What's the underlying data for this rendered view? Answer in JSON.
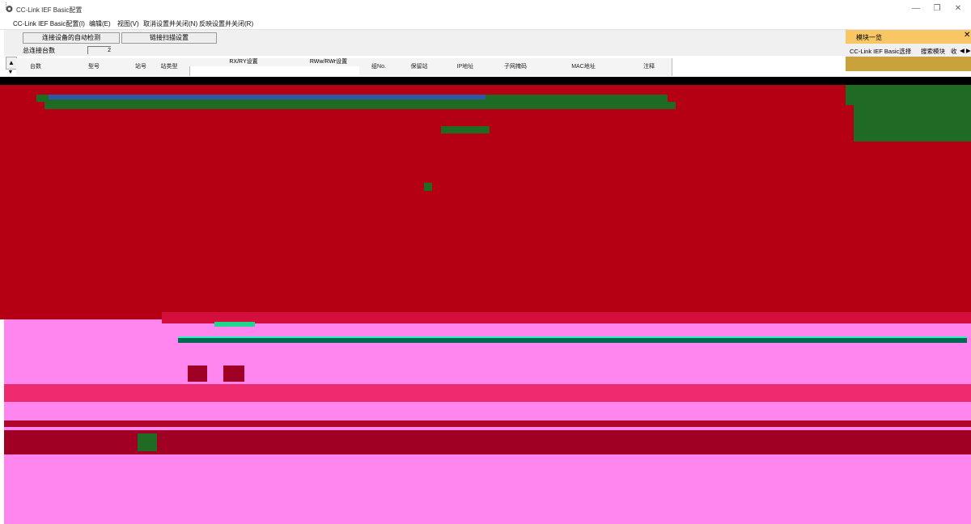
{
  "window": {
    "title": "CC-Link IEF Basic配置",
    "minimize_glyph": "—",
    "restore_glyph": "❐",
    "close_glyph": "✕"
  },
  "menu": [
    "CC-Link IEF Basic配置(I)",
    "编辑(E)",
    "视图(V)",
    "取消设置并关闭(N)",
    "反映设置并关闭(R)"
  ],
  "toolbar": {
    "auto_detect": "连接设备的自动检测",
    "link_scan": "链接扫描设置"
  },
  "connection": {
    "label": "总连接台数",
    "value": "2"
  },
  "table": {
    "headers": [
      "台数",
      "型号",
      "站号",
      "站类型",
      "RX/RY设置",
      "RWw/RWr设置",
      "组No.",
      "保留站",
      "IP地址",
      "子网掩码",
      "MAC地址",
      "注释"
    ],
    "scroll_up": "▲",
    "scroll_down": "▼"
  },
  "panel": {
    "title": "模块一览",
    "close": "✕",
    "tabs": [
      "CC-Link IEF Basic选择",
      "搜索模块",
      "收"
    ],
    "tab_nav": "◀ ▶"
  }
}
